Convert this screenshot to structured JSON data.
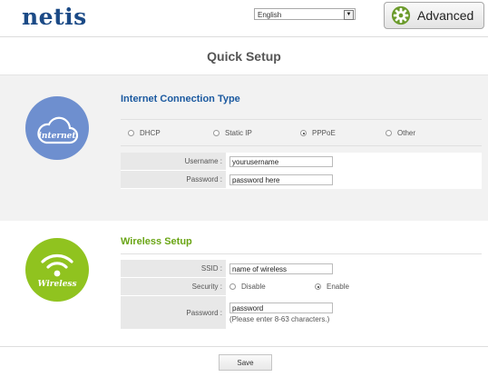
{
  "header": {
    "logo": "netis",
    "language": "English",
    "advanced_label": "Advanced"
  },
  "page_title": "Quick Setup",
  "internet": {
    "icon_caption": "internet",
    "title": "Internet Connection Type",
    "options": [
      {
        "label": "DHCP",
        "checked": false
      },
      {
        "label": "Static IP",
        "checked": false
      },
      {
        "label": "PPPoE",
        "checked": true
      },
      {
        "label": "Other",
        "checked": false
      }
    ],
    "username_label": "Username :",
    "username_value": "yourusername",
    "password_label": "Password :",
    "password_value": "password here"
  },
  "wireless": {
    "icon_caption": "Wireless",
    "title": "Wireless Setup",
    "ssid_label": "SSID :",
    "ssid_value": "name of wireless",
    "security_label": "Security :",
    "security_options": [
      {
        "label": "Disable",
        "checked": false
      },
      {
        "label": "Enable",
        "checked": true
      }
    ],
    "password_label": "Password :",
    "password_value": "password",
    "password_hint": "(Please enter 8-63 characters.)"
  },
  "save_label": "Save",
  "colors": {
    "brand_blue": "#1b4a86",
    "internet_blue": "#6e8fcf",
    "wireless_green": "#90c31f",
    "title_blue": "#1c5aa0",
    "title_green": "#6aa515"
  }
}
